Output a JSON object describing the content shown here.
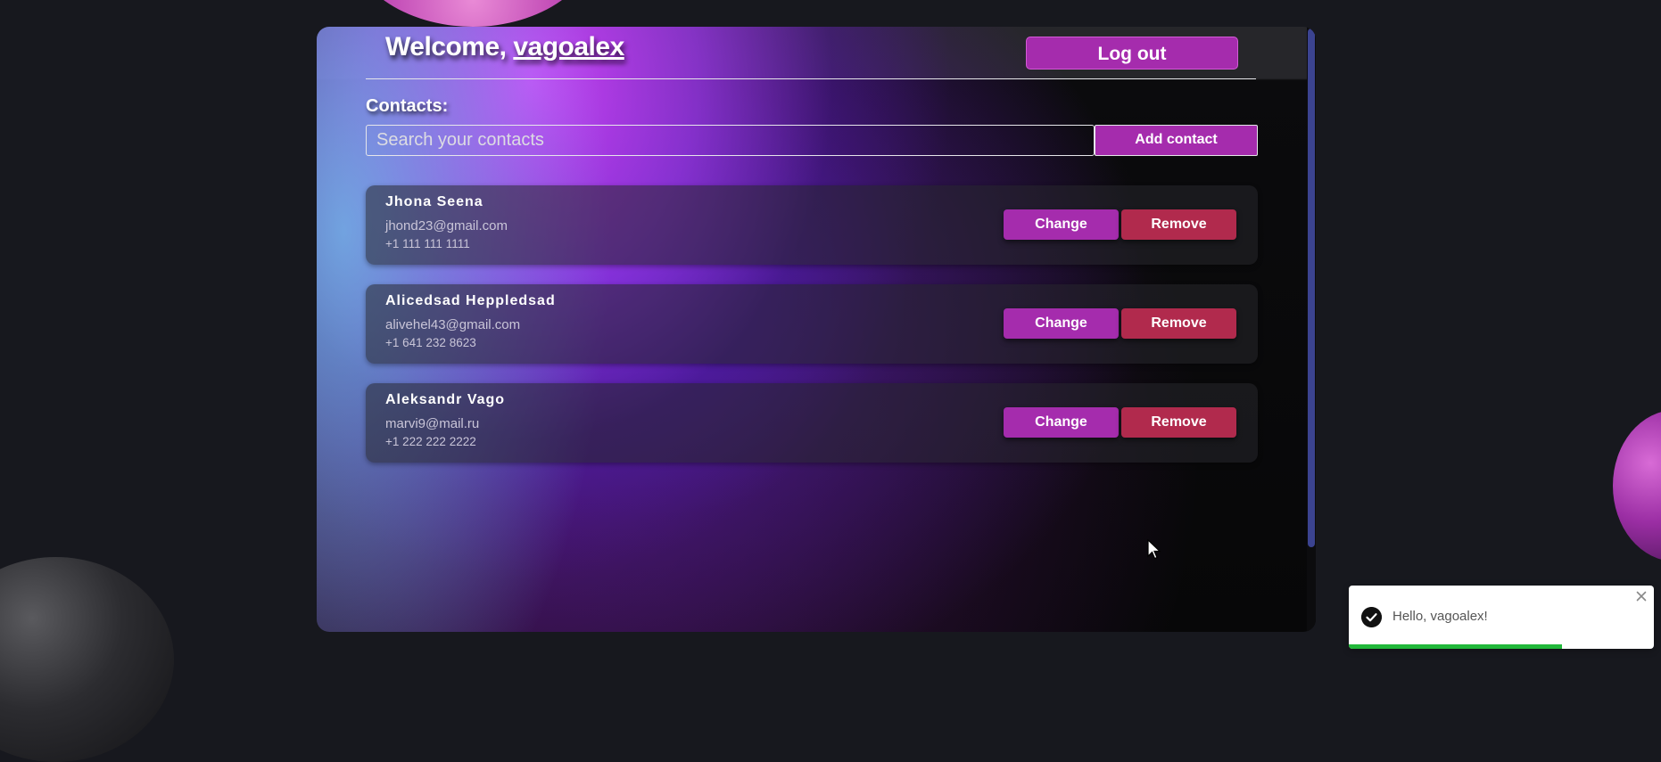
{
  "header": {
    "welcome_prefix": "Welcome,",
    "username": "vagoalex",
    "logout_label": "Log out"
  },
  "contacts": {
    "title": "Contacts:",
    "search_placeholder": "Search your contacts",
    "search_value": "",
    "add_label": "Add contact",
    "items": [
      {
        "name": "Jhona Seena",
        "email": "jhond23@gmail.com",
        "phone": "+1 111 111 1111",
        "change_label": "Change",
        "remove_label": "Remove"
      },
      {
        "name": "Alicedsad Heppledsad",
        "email": "alivehel43@gmail.com",
        "phone": "+1 641 232 8623",
        "change_label": "Change",
        "remove_label": "Remove"
      },
      {
        "name": "Aleksandr Vago",
        "email": "marvi9@mail.ru",
        "phone": "+1 222 222 2222",
        "change_label": "Change",
        "remove_label": "Remove"
      }
    ]
  },
  "toast": {
    "message": "Hello, vagoalex!",
    "progress": 0.7,
    "icon": "check-circle-icon",
    "close_icon": "close-icon"
  },
  "colors": {
    "accent": "#a52cad",
    "danger": "#b12a4d",
    "page_background": "#17181e",
    "toast_progress": "#22b83a"
  }
}
